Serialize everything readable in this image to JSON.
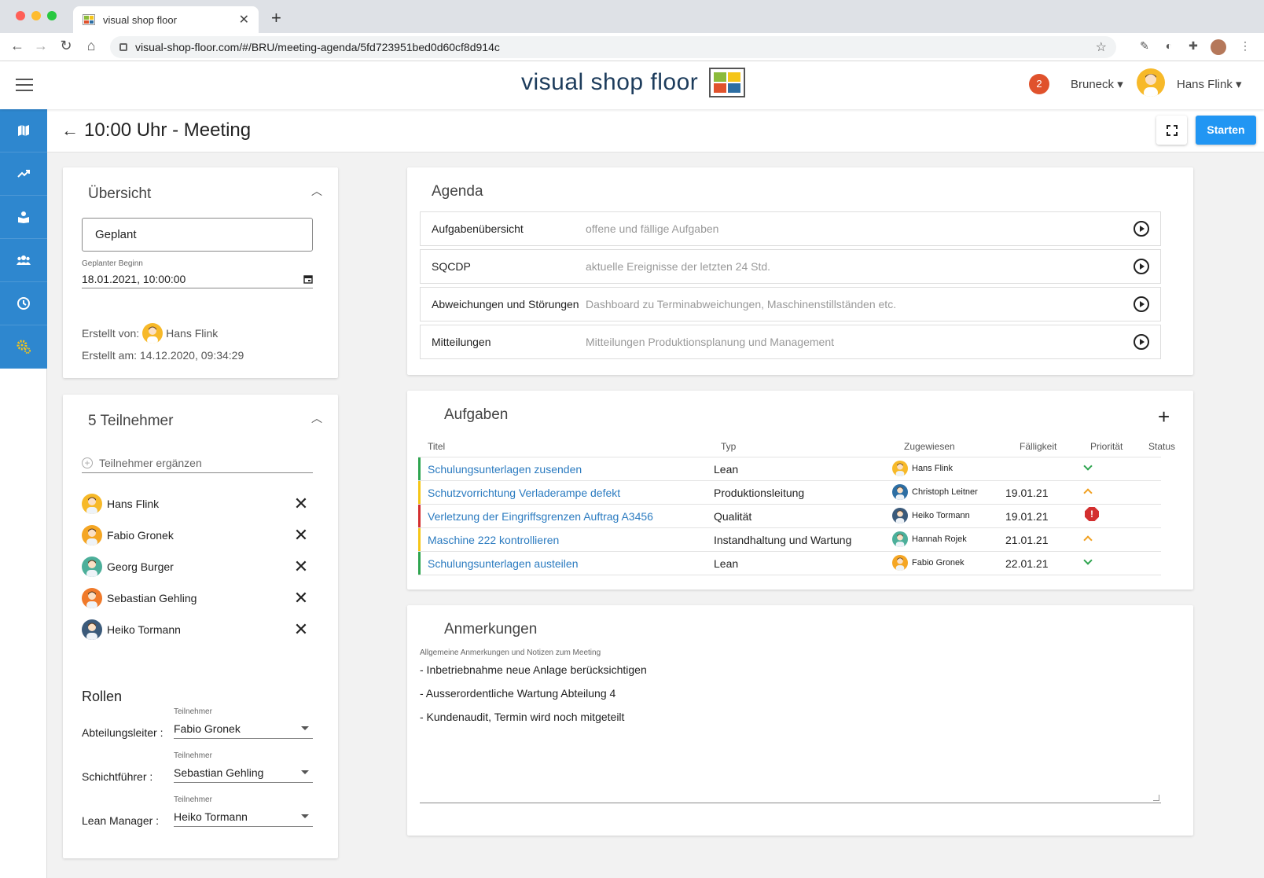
{
  "browser": {
    "tab_title": "visual shop floor",
    "url": "visual-shop-floor.com/#/BRU/meeting-agenda/5fd723951bed0d60cf8d914c"
  },
  "header": {
    "logo_text": "visual shop floor",
    "notification_count": "2",
    "location": "Bruneck",
    "user": "Hans Flink"
  },
  "sidebar": {
    "items": [
      {
        "icon": "map-icon"
      },
      {
        "icon": "trend-icon"
      },
      {
        "icon": "book-icon"
      },
      {
        "icon": "users-icon"
      },
      {
        "icon": "clock-icon"
      },
      {
        "icon": "gears-icon"
      }
    ]
  },
  "page": {
    "title": "10:00 Uhr - Meeting",
    "start_label": "Starten"
  },
  "overview": {
    "heading": "Übersicht",
    "status": "Geplant",
    "planned_label": "Geplanter Beginn",
    "planned_value": "18.01.2021, 10:00:00",
    "created_by_label": "Erstellt von:",
    "created_by": "Hans Flink",
    "created_at": "Erstellt am: 14.12.2020, 09:34:29"
  },
  "participants": {
    "heading": "5 Teilnehmer",
    "add_placeholder": "Teilnehmer ergänzen",
    "list": [
      {
        "name": "Hans Flink",
        "color": "#f7b929"
      },
      {
        "name": "Fabio Gronek",
        "color": "#f5a623"
      },
      {
        "name": "Georg Burger",
        "color": "#4caf9a"
      },
      {
        "name": "Sebastian Gehling",
        "color": "#f07a2a"
      },
      {
        "name": "Heiko Tormann",
        "color": "#3b5a7a"
      }
    ]
  },
  "roles": {
    "heading": "Rollen",
    "select_label": "Teilnehmer",
    "items": [
      {
        "role": "Abteilungsleiter :",
        "value": "Fabio Gronek"
      },
      {
        "role": "Schichtführer :",
        "value": "Sebastian Gehling"
      },
      {
        "role": "Lean Manager :",
        "value": "Heiko Tormann"
      }
    ]
  },
  "agenda": {
    "heading": "Agenda",
    "items": [
      {
        "name": "Aufgabenübersicht",
        "desc": "offene und fällige Aufgaben"
      },
      {
        "name": "SQCDP",
        "desc": "aktuelle Ereignisse der letzten 24 Std."
      },
      {
        "name": "Abweichungen und Störungen",
        "desc": "Dashboard zu Terminabweichungen, Maschinenstillständen etc."
      },
      {
        "name": "Mitteilungen",
        "desc": "Mitteilungen Produktionsplanung und Management"
      }
    ]
  },
  "tasks": {
    "heading": "Aufgaben",
    "columns": [
      "Titel",
      "Typ",
      "Zugewiesen",
      "Fälligkeit",
      "Priorität",
      "Status"
    ],
    "rows": [
      {
        "title": "Schulungsunterlagen zusenden",
        "type": "Lean",
        "assignee": "Hans Flink",
        "due": "",
        "priority": "low",
        "bar": "#2ea44f",
        "avatar": "#f7b929"
      },
      {
        "title": "Schutzvorrichtung Verladerampe defekt",
        "type": "Produktionsleitung",
        "assignee": "Christoph Leitner",
        "due": "19.01.21",
        "priority": "medium",
        "bar": "#f5c518",
        "avatar": "#2d6ea3"
      },
      {
        "title": "Verletzung der Eingriffsgrenzen Auftrag A3456",
        "type": "Qualität",
        "assignee": "Heiko Tormann",
        "due": "19.01.21",
        "priority": "critical",
        "bar": "#d32f2f",
        "avatar": "#3b5a7a"
      },
      {
        "title": "Maschine 222 kontrollieren",
        "type": "Instandhaltung und Wartung",
        "assignee": "Hannah Rojek",
        "due": "21.01.21",
        "priority": "medium",
        "bar": "#f5c518",
        "avatar": "#4caf9a"
      },
      {
        "title": "Schulungsunterlagen austeilen",
        "type": "Lean",
        "assignee": "Fabio Gronek",
        "due": "22.01.21",
        "priority": "low",
        "bar": "#2ea44f",
        "avatar": "#f5a623"
      }
    ]
  },
  "notes": {
    "heading": "Anmerkungen",
    "label": "Allgemeine Anmerkungen und Notizen zum Meeting",
    "lines": [
      "- Inbetriebnahme neue Anlage berücksichtigen",
      "- Ausserordentliche Wartung Abteilung 4",
      "- Kundenaudit, Termin wird noch mitgeteilt"
    ]
  }
}
